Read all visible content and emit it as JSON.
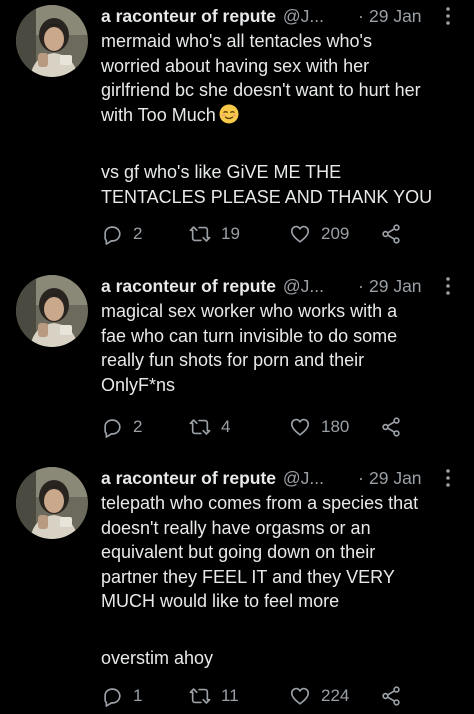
{
  "tweets": [
    {
      "author": "a raconteur of repute",
      "handle": "@J...",
      "separator": "·",
      "date": "29 Jan",
      "text_lines": [
        "mermaid who's all tentacles who's",
        "worried about having sex with her",
        "girlfriend bc she doesn't want to hurt her",
        "with Too Much"
      ],
      "emoji": "relieved-face-icon",
      "text_lines_2": [
        "vs gf who's like GiVE ME THE",
        "TENTACLES PLEASE AND THANK YOU"
      ],
      "replies": "2",
      "retweets": "19",
      "likes": "209"
    },
    {
      "author": "a raconteur of repute",
      "handle": "@J...",
      "separator": "·",
      "date": "29 Jan",
      "text_lines": [
        "magical sex worker who works with a",
        "fae who can turn invisible to do some",
        "really fun shots for porn and their",
        "OnlyF*ns"
      ],
      "replies": "2",
      "retweets": "4",
      "likes": "180"
    },
    {
      "author": "a raconteur of repute",
      "handle": "@J...",
      "separator": "·",
      "date": "29 Jan",
      "text_lines": [
        "telepath who comes from a species that",
        "doesn't really have orgasms or an",
        "equivalent but going down on their",
        "partner they FEEL IT and they VERY",
        "MUCH would like to feel more"
      ],
      "text_lines_2": [
        "overstim ahoy"
      ],
      "replies": "1",
      "retweets": "11",
      "likes": "224"
    }
  ],
  "colors": {
    "background": "#000000",
    "text": "#e7e9ea",
    "secondary": "#9aa0a6"
  }
}
